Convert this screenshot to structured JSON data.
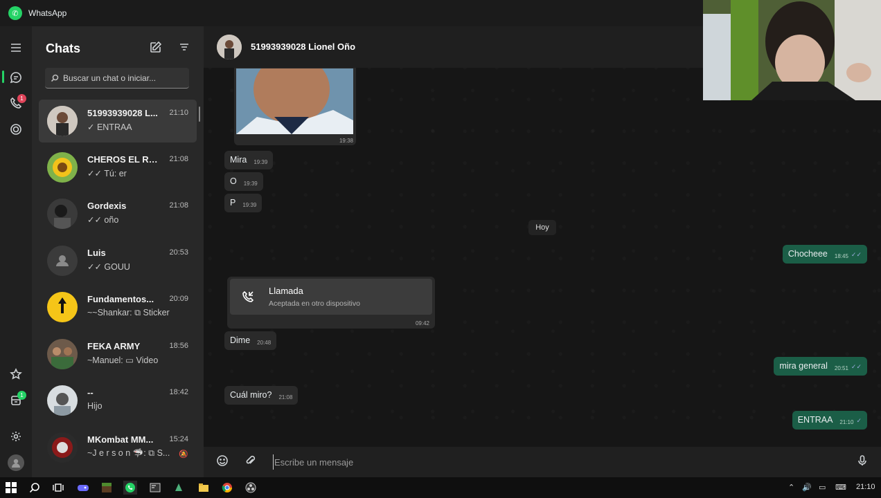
{
  "window": {
    "title": "WhatsApp"
  },
  "rail": {
    "calls_badge": "1",
    "archived_badge": "1"
  },
  "chatlist": {
    "heading": "Chats",
    "search_placeholder": "Buscar un chat o iniciar...",
    "items": [
      {
        "name": "51993939028 L...",
        "time": "21:10",
        "preview": "✓ ENTRAA"
      },
      {
        "name": "CHEROS EL RE...",
        "time": "21:08",
        "preview": "✓✓ Tú: er"
      },
      {
        "name": "Gordexis",
        "time": "21:08",
        "preview": "✓✓ oño"
      },
      {
        "name": "Luis",
        "time": "20:53",
        "preview": "✓✓ GOUU"
      },
      {
        "name": "Fundamentos...",
        "time": "20:09",
        "preview": "~~Shankar: ⧉ Sticker"
      },
      {
        "name": "FEKA ARMY",
        "time": "18:56",
        "preview": "~Manuel: ▭ Video"
      },
      {
        "name": "--",
        "time": "18:42",
        "preview": "Hijo"
      },
      {
        "name": "MKombat MM...",
        "time": "15:24",
        "preview": "~J e r s o n 🦈: ⧉ S..."
      }
    ]
  },
  "conversation": {
    "contact": "51993939028 Lionel Oño",
    "image_time": "19:38",
    "messages_in": [
      {
        "text": "Mira",
        "time": "19:39"
      },
      {
        "text": "O",
        "time": "19:39"
      },
      {
        "text": "P",
        "time": "19:39"
      },
      {
        "text": "Dime",
        "time": "20:48"
      },
      {
        "text": "Cuál miro?",
        "time": "21:08"
      }
    ],
    "day_chip": "Hoy",
    "messages_out": [
      {
        "text": "Chocheee",
        "time": "18:45"
      },
      {
        "text": "mira general",
        "time": "20:51"
      },
      {
        "text": "ENTRAA",
        "time": "21:10"
      }
    ],
    "call": {
      "title": "Llamada",
      "subtitle": "Aceptada en otro dispositivo",
      "time": "09:42"
    },
    "composer_placeholder": "Escribe un mensaje"
  },
  "taskbar": {
    "clock": "21:10"
  },
  "colors": {
    "accent": "#25d366",
    "outgoing_bubble": "#1b5e47",
    "incoming_bubble": "#2a2a2a"
  }
}
